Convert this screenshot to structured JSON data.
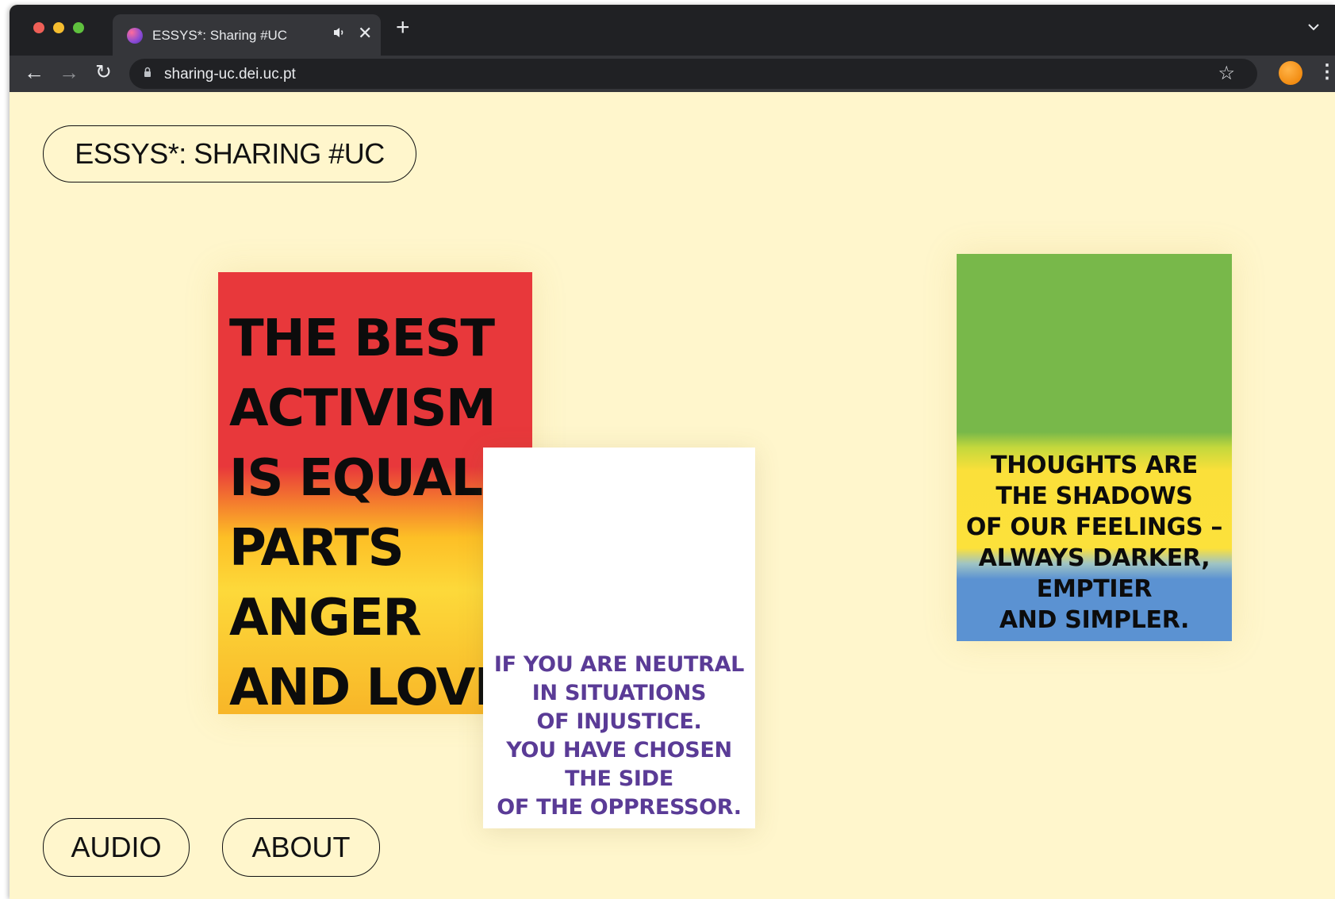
{
  "browser": {
    "tab_title": "ESSYS*: Sharing #UC",
    "tab_audio_icon": "speaker-icon",
    "tab_close": "✕",
    "new_tab": "+",
    "tab_menu": "⌄",
    "url": "sharing-uc.dei.uc.pt",
    "nav_back": "←",
    "nav_forward": "→",
    "reload": "↻",
    "bookmark_star": "☆",
    "menu": "⋮"
  },
  "site": {
    "title": "ESSYS*: SHARING #UC",
    "audio_label": "AUDIO",
    "about_label": "ABOUT",
    "background_color": "#fff6cc"
  },
  "posters": [
    {
      "text": "THE BEST\nACTIVISM\nIS EQUAL\nPARTS\nANGER\nAND LOVE",
      "colors": [
        "#e8383b",
        "#fdbf26"
      ]
    },
    {
      "text": "IF YOU ARE NEUTRAL\nIN SITUATIONS\nOF INJUSTICE.\nYOU HAVE CHOSEN\nTHE SIDE\nOF THE OPPRESSOR.",
      "colors": [
        "#ffffff",
        "#5a3b96"
      ]
    },
    {
      "text": "THOUGHTS ARE\nTHE SHADOWS\nOF OUR FEELINGS –\nALWAYS DARKER,\nEMPTIER\nAND SIMPLER.",
      "colors": [
        "#78b84a",
        "#fce13b",
        "#5b92d2"
      ]
    }
  ]
}
